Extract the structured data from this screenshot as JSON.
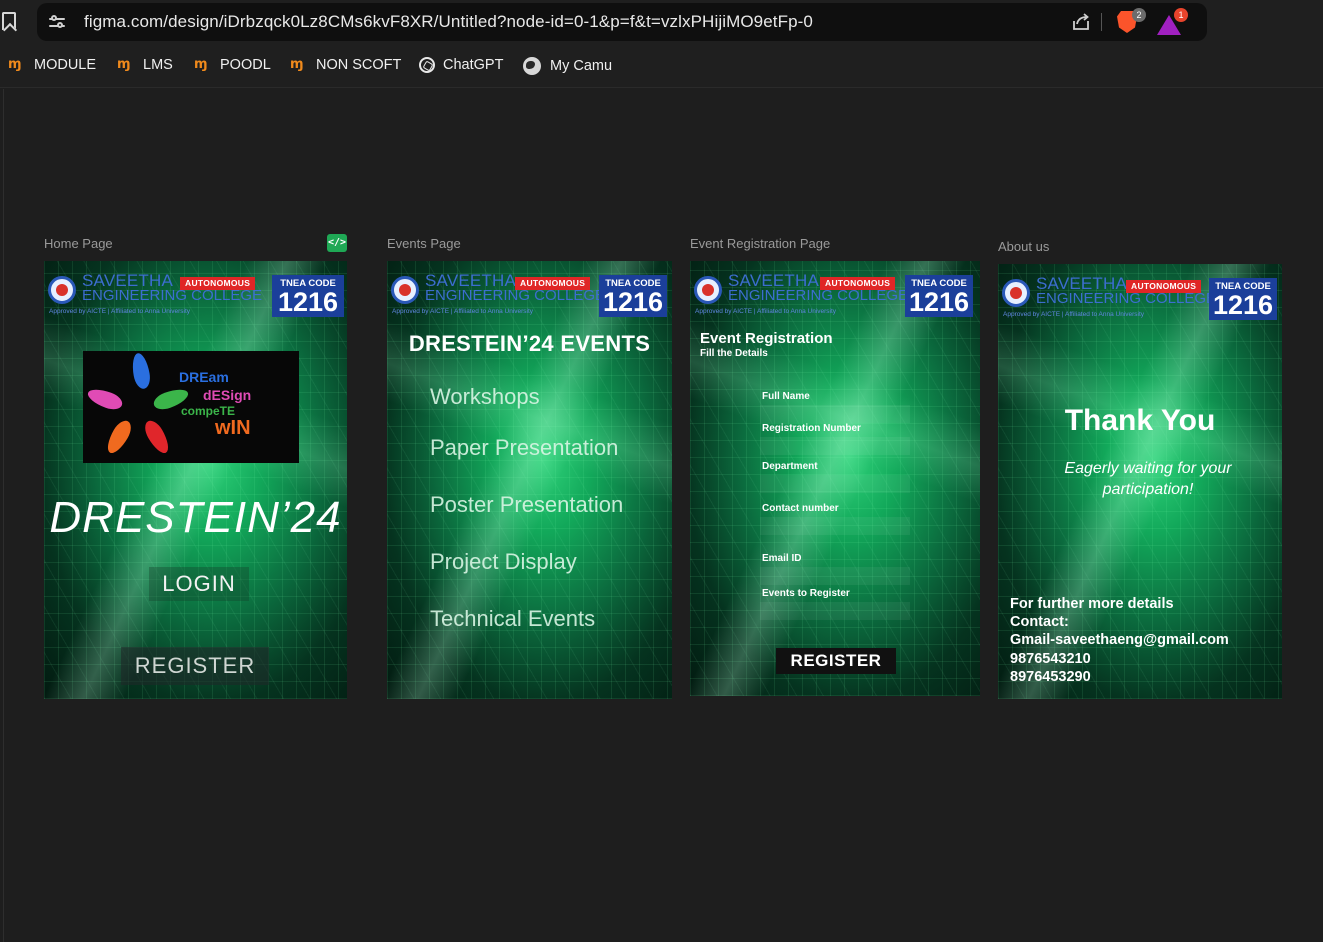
{
  "browser": {
    "url": "figma.com/design/iDrbzqck0Lz8CMs6kvF8XR/Untitled?node-id=0-1&p=f&t=vzlxPHijiMO9etFp-0",
    "brave_badge": "2",
    "rewards_badge": "1"
  },
  "bookmarks": [
    {
      "label": "MODULE",
      "icon": "moodle-icon"
    },
    {
      "label": "LMS",
      "icon": "moodle-icon"
    },
    {
      "label": "POODL",
      "icon": "moodle-icon"
    },
    {
      "label": "NON SCOFT",
      "icon": "moodle-icon"
    },
    {
      "label": "ChatGPT",
      "icon": "chatgpt-icon"
    },
    {
      "label": "My Camu",
      "icon": "globe-icon"
    }
  ],
  "frames": {
    "labels": [
      "Home Page",
      "Events Page",
      "Event Registration Page",
      "About us"
    ],
    "code_badge": "</>"
  },
  "college_header": {
    "name_line1": "SAVEETHA",
    "name_line2": "ENGINEERING COLLEGE",
    "approved": "Approved by AICTE | Affiliated to Anna University",
    "autonomous": "AUTONOMOUS",
    "tnea_label": "TNEA CODE",
    "tnea_code": "1216"
  },
  "home": {
    "logo_words": [
      "DREam",
      "dESign",
      "compeTE",
      "wIN"
    ],
    "title": "DRESTEIN’24",
    "login": "LOGIN",
    "register": "REGISTER"
  },
  "events": {
    "title": "DRESTEIN’24 EVENTS",
    "items": [
      "Workshops",
      "Paper Presentation",
      "Poster Presentation",
      "Project Display",
      "Technical Events"
    ]
  },
  "registration": {
    "title": "Event Registration",
    "subtitle": "Fill the Details",
    "fields": [
      "Full Name",
      "Registration Number",
      "Department",
      "Contact number",
      "Email ID",
      "Events to Register"
    ],
    "register": "REGISTER"
  },
  "about": {
    "thanks": "Thank You",
    "waiting": "Eagerly waiting for your participation!",
    "lines": [
      "For further more details",
      "Contact:",
      "Gmail-saveethaeng@gmail.com",
      "9876543210",
      "8976453290"
    ]
  },
  "colors": {
    "canvas_bg": "#1e1e1e",
    "accent_green": "#1fa855",
    "autonomous_red": "#e02626",
    "tnea_blue": "#1b3f9a"
  }
}
